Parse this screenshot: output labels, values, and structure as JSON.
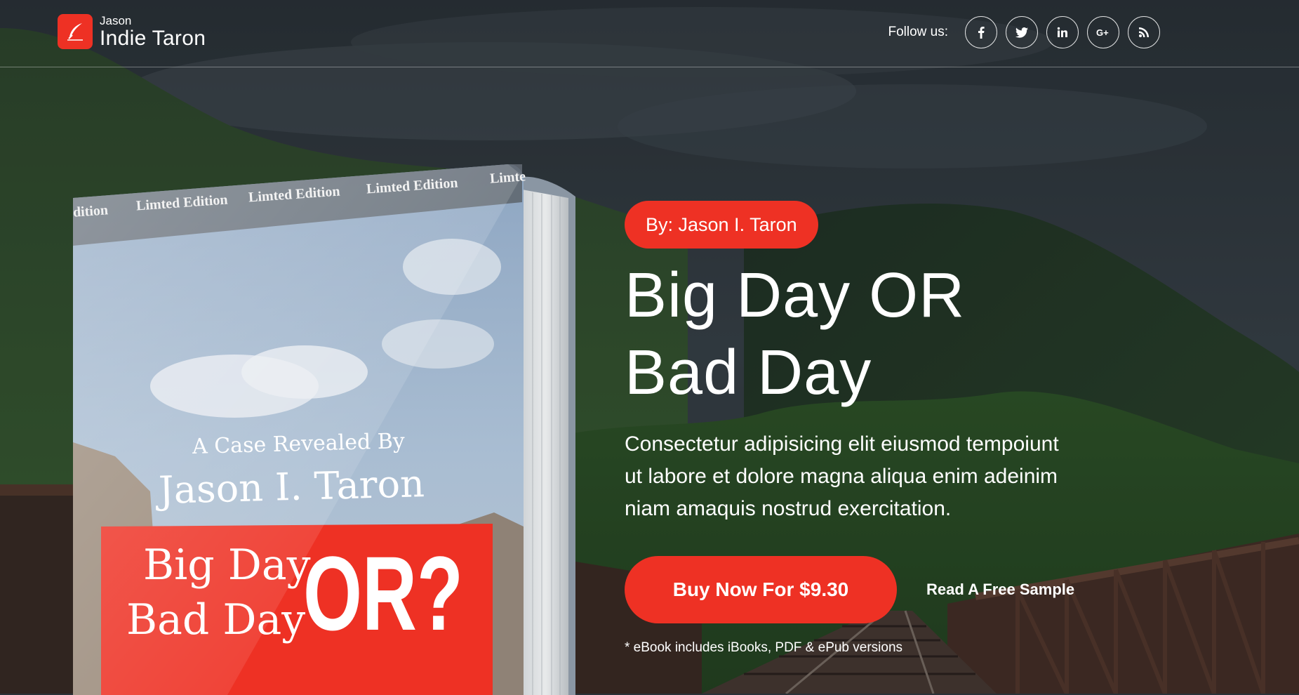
{
  "brand": {
    "small": "Jason",
    "name": "Indie Taron",
    "accent": "#ee3124"
  },
  "header": {
    "follow_label": "Follow us:",
    "social": [
      {
        "icon": "facebook-icon",
        "glyph": "f"
      },
      {
        "icon": "twitter-icon",
        "glyph": "t"
      },
      {
        "icon": "linkedin-icon",
        "glyph": "in"
      },
      {
        "icon": "google-plus-icon",
        "glyph": "G+"
      },
      {
        "icon": "rss-icon",
        "glyph": "rss"
      }
    ]
  },
  "book": {
    "band_text": [
      "dition",
      "Limted Edition",
      "Limted Edition",
      "Limted Edition",
      "Limte"
    ],
    "reveal": "A Case Revealed By",
    "author": "Jason I. Taron",
    "title_line1": "Big Day",
    "title_line2": "Bad Day",
    "title_or": "OR?"
  },
  "hero": {
    "byline": "By: Jason I. Taron",
    "title_line1": "Big Day OR",
    "title_line2": "Bad Day",
    "desc_line1": "Consectetur adipisicing elit eiusmod tempoiunt",
    "desc_line2": "ut labore et dolore magna aliqua enim adeinim",
    "desc_line3": "niam amaquis nostrud exercitation.",
    "buy_label": "Buy Now For $9.30",
    "sample_label": "Read A Free Sample",
    "note": "* eBook includes iBooks, PDF & ePub versions"
  }
}
